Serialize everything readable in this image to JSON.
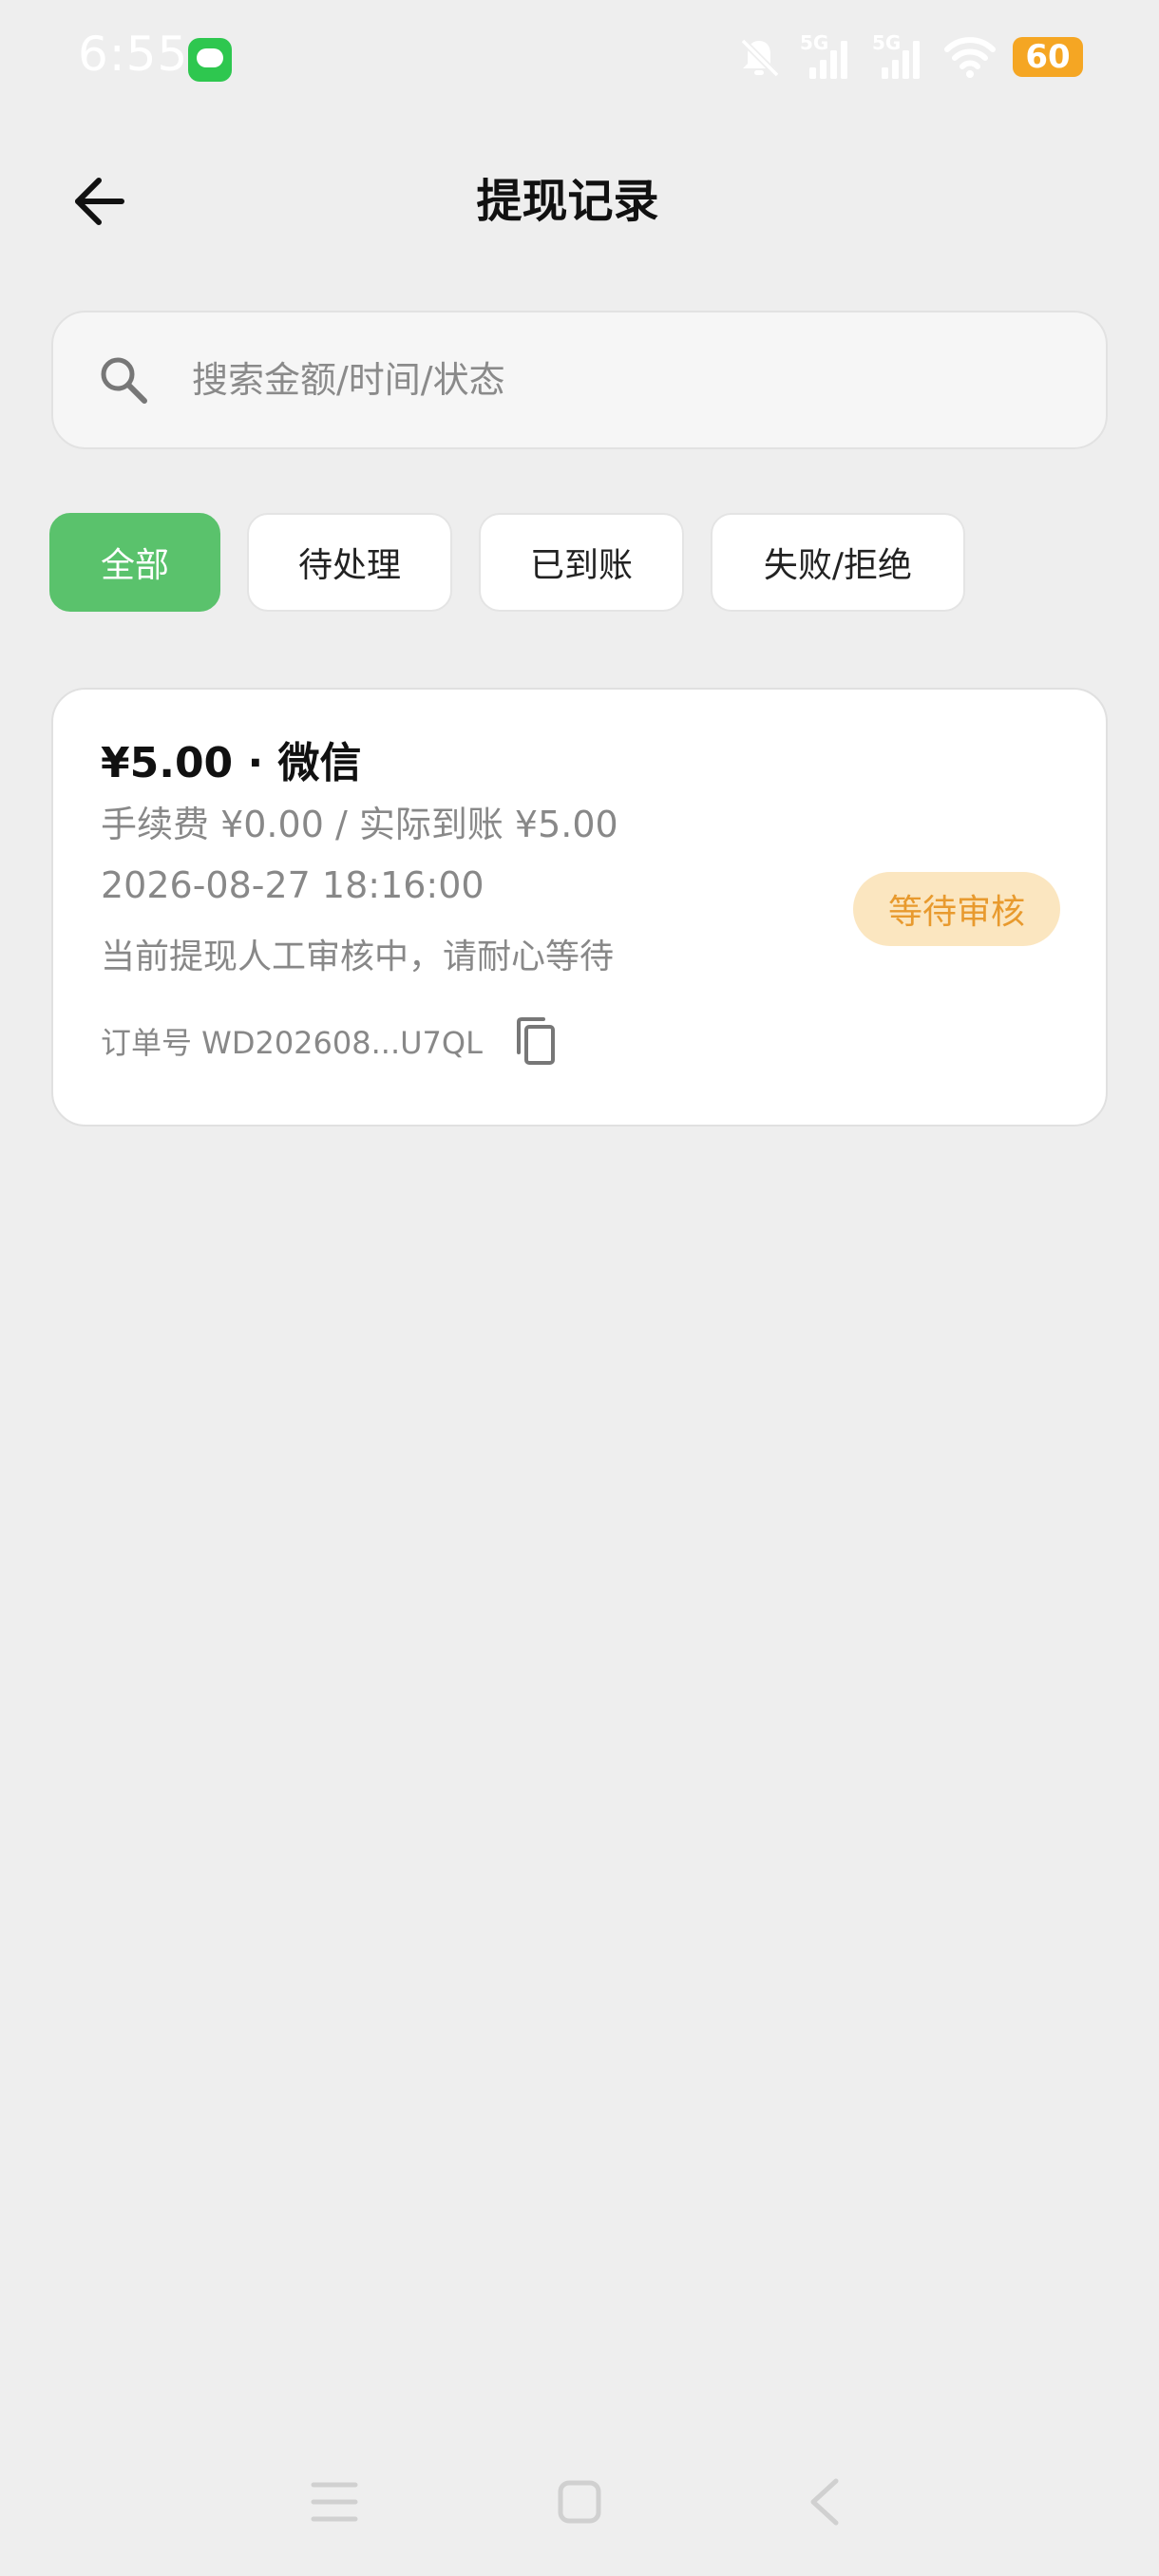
{
  "status_bar": {
    "time": "6:55",
    "network_1": "5G",
    "network_2": "5G",
    "battery": "60"
  },
  "header": {
    "title": "提现记录"
  },
  "search": {
    "placeholder": "搜索金额/时间/状态",
    "value": ""
  },
  "tabs": [
    {
      "label": "全部",
      "active": true
    },
    {
      "label": "待处理",
      "active": false
    },
    {
      "label": "已到账",
      "active": false
    },
    {
      "label": "失败/拒绝",
      "active": false
    }
  ],
  "records": [
    {
      "title": "¥5.00 · 微信",
      "fee_line": "手续费 ¥0.00 / 实际到账 ¥5.00",
      "time": "2026-08-27 18:16:00",
      "note": "当前提现人工审核中，请耐心等待",
      "order_no": "订单号 WD202608...U7QL",
      "status": "等待审核"
    }
  ],
  "colors": {
    "accent_green": "#5ac26c",
    "badge_bg": "#fbe6c0",
    "badge_text": "#e89a2e",
    "battery": "#f5a623"
  },
  "icons": {
    "back": "arrow-left-icon",
    "search": "search-icon",
    "copy": "copy-icon"
  }
}
